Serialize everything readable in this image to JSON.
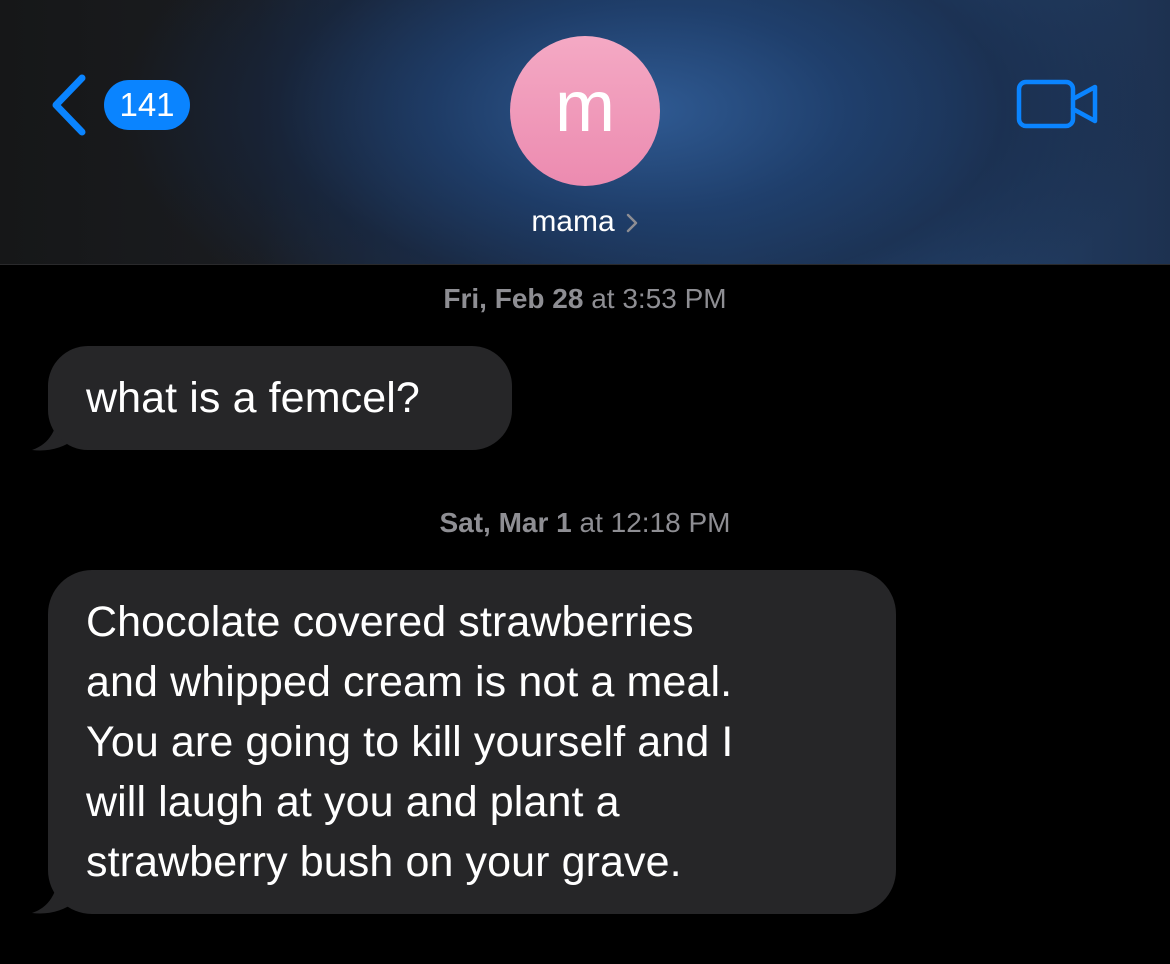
{
  "header": {
    "back_badge_count": "141",
    "avatar_initial": "m",
    "contact_name": "mama",
    "icons": {
      "back": "chevron-left-icon",
      "contact_details": "chevron-right-icon",
      "video_call": "video-camera-icon"
    },
    "colors": {
      "accent": "#0a84ff",
      "avatar": "#f09bbb"
    }
  },
  "conversation": {
    "messages": [
      {
        "timestamp_day": "Fri, Feb 28",
        "timestamp_time": "at 3:53 PM",
        "direction": "incoming",
        "text": "what is a femcel?"
      },
      {
        "timestamp_day": "Sat, Mar 1",
        "timestamp_time": "at 12:18 PM",
        "direction": "incoming",
        "text": "Chocolate covered strawberries\nand whipped cream is not a meal.\nYou are going to kill yourself and I\nwill laugh at you and plant a\nstrawberry bush on your grave."
      }
    ],
    "colors": {
      "bubble": "#262628",
      "timestamp": "#8e8e93"
    }
  }
}
